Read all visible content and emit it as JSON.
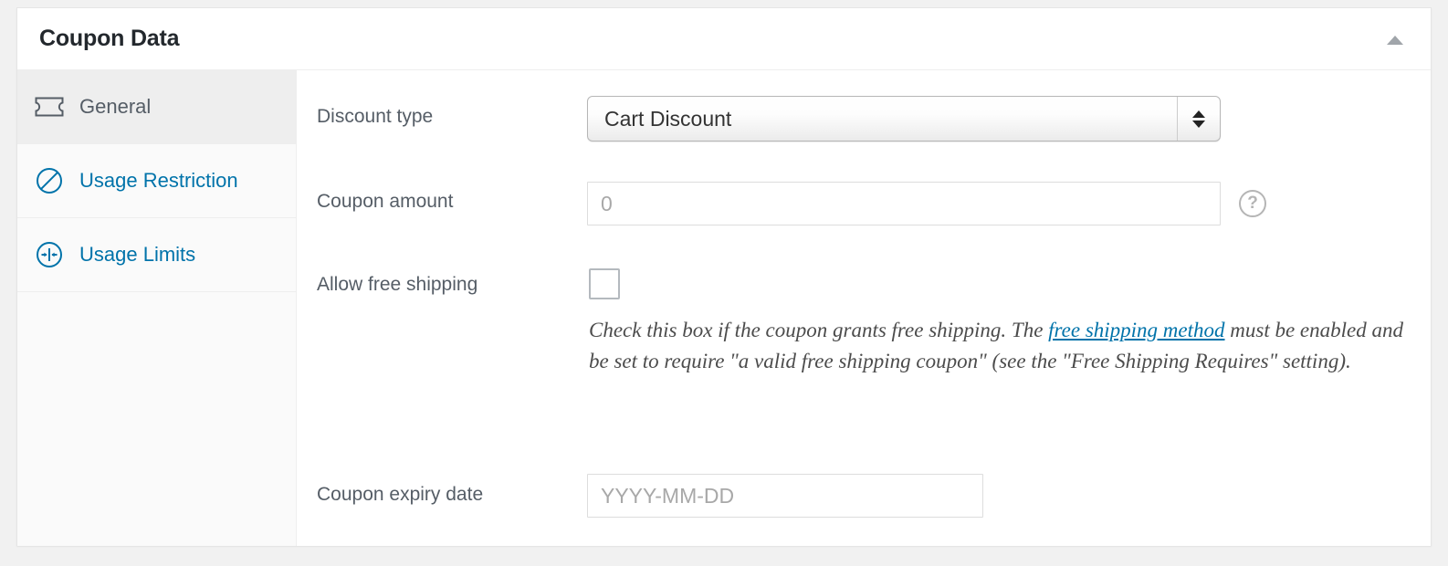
{
  "panel": {
    "title": "Coupon Data",
    "toggle_icon": "triangle-up-icon",
    "toggle_label": "Toggle panel"
  },
  "tabs": [
    {
      "id": "general",
      "label": "General",
      "icon": "ticket-icon",
      "active": true
    },
    {
      "id": "usage-restriction",
      "label": "Usage Restriction",
      "icon": "no-entry-icon",
      "active": false
    },
    {
      "id": "usage-limits",
      "label": "Usage Limits",
      "icon": "limit-arrows-icon",
      "active": false
    }
  ],
  "fields": {
    "discount_type": {
      "label": "Discount type",
      "value": "Cart Discount",
      "options": [
        "Cart Discount"
      ]
    },
    "coupon_amount": {
      "label": "Coupon amount",
      "value": "",
      "placeholder": "0",
      "help_icon": "question-mark-icon"
    },
    "free_shipping": {
      "label": "Allow free shipping",
      "checked": false,
      "description_before": "Check this box if the coupon grants free shipping. The ",
      "description_link": "free shipping method",
      "description_after": " must be enabled and be set to require \"a valid free shipping coupon\" (see the \"Free Shipping Requires\" setting)."
    },
    "expiry_date": {
      "label": "Coupon expiry date",
      "value": "",
      "placeholder": "YYYY-MM-DD"
    }
  },
  "colors": {
    "link": "#0073aa",
    "label": "#555d66",
    "title": "#23282d",
    "page_bg": "#f1f1f1"
  }
}
